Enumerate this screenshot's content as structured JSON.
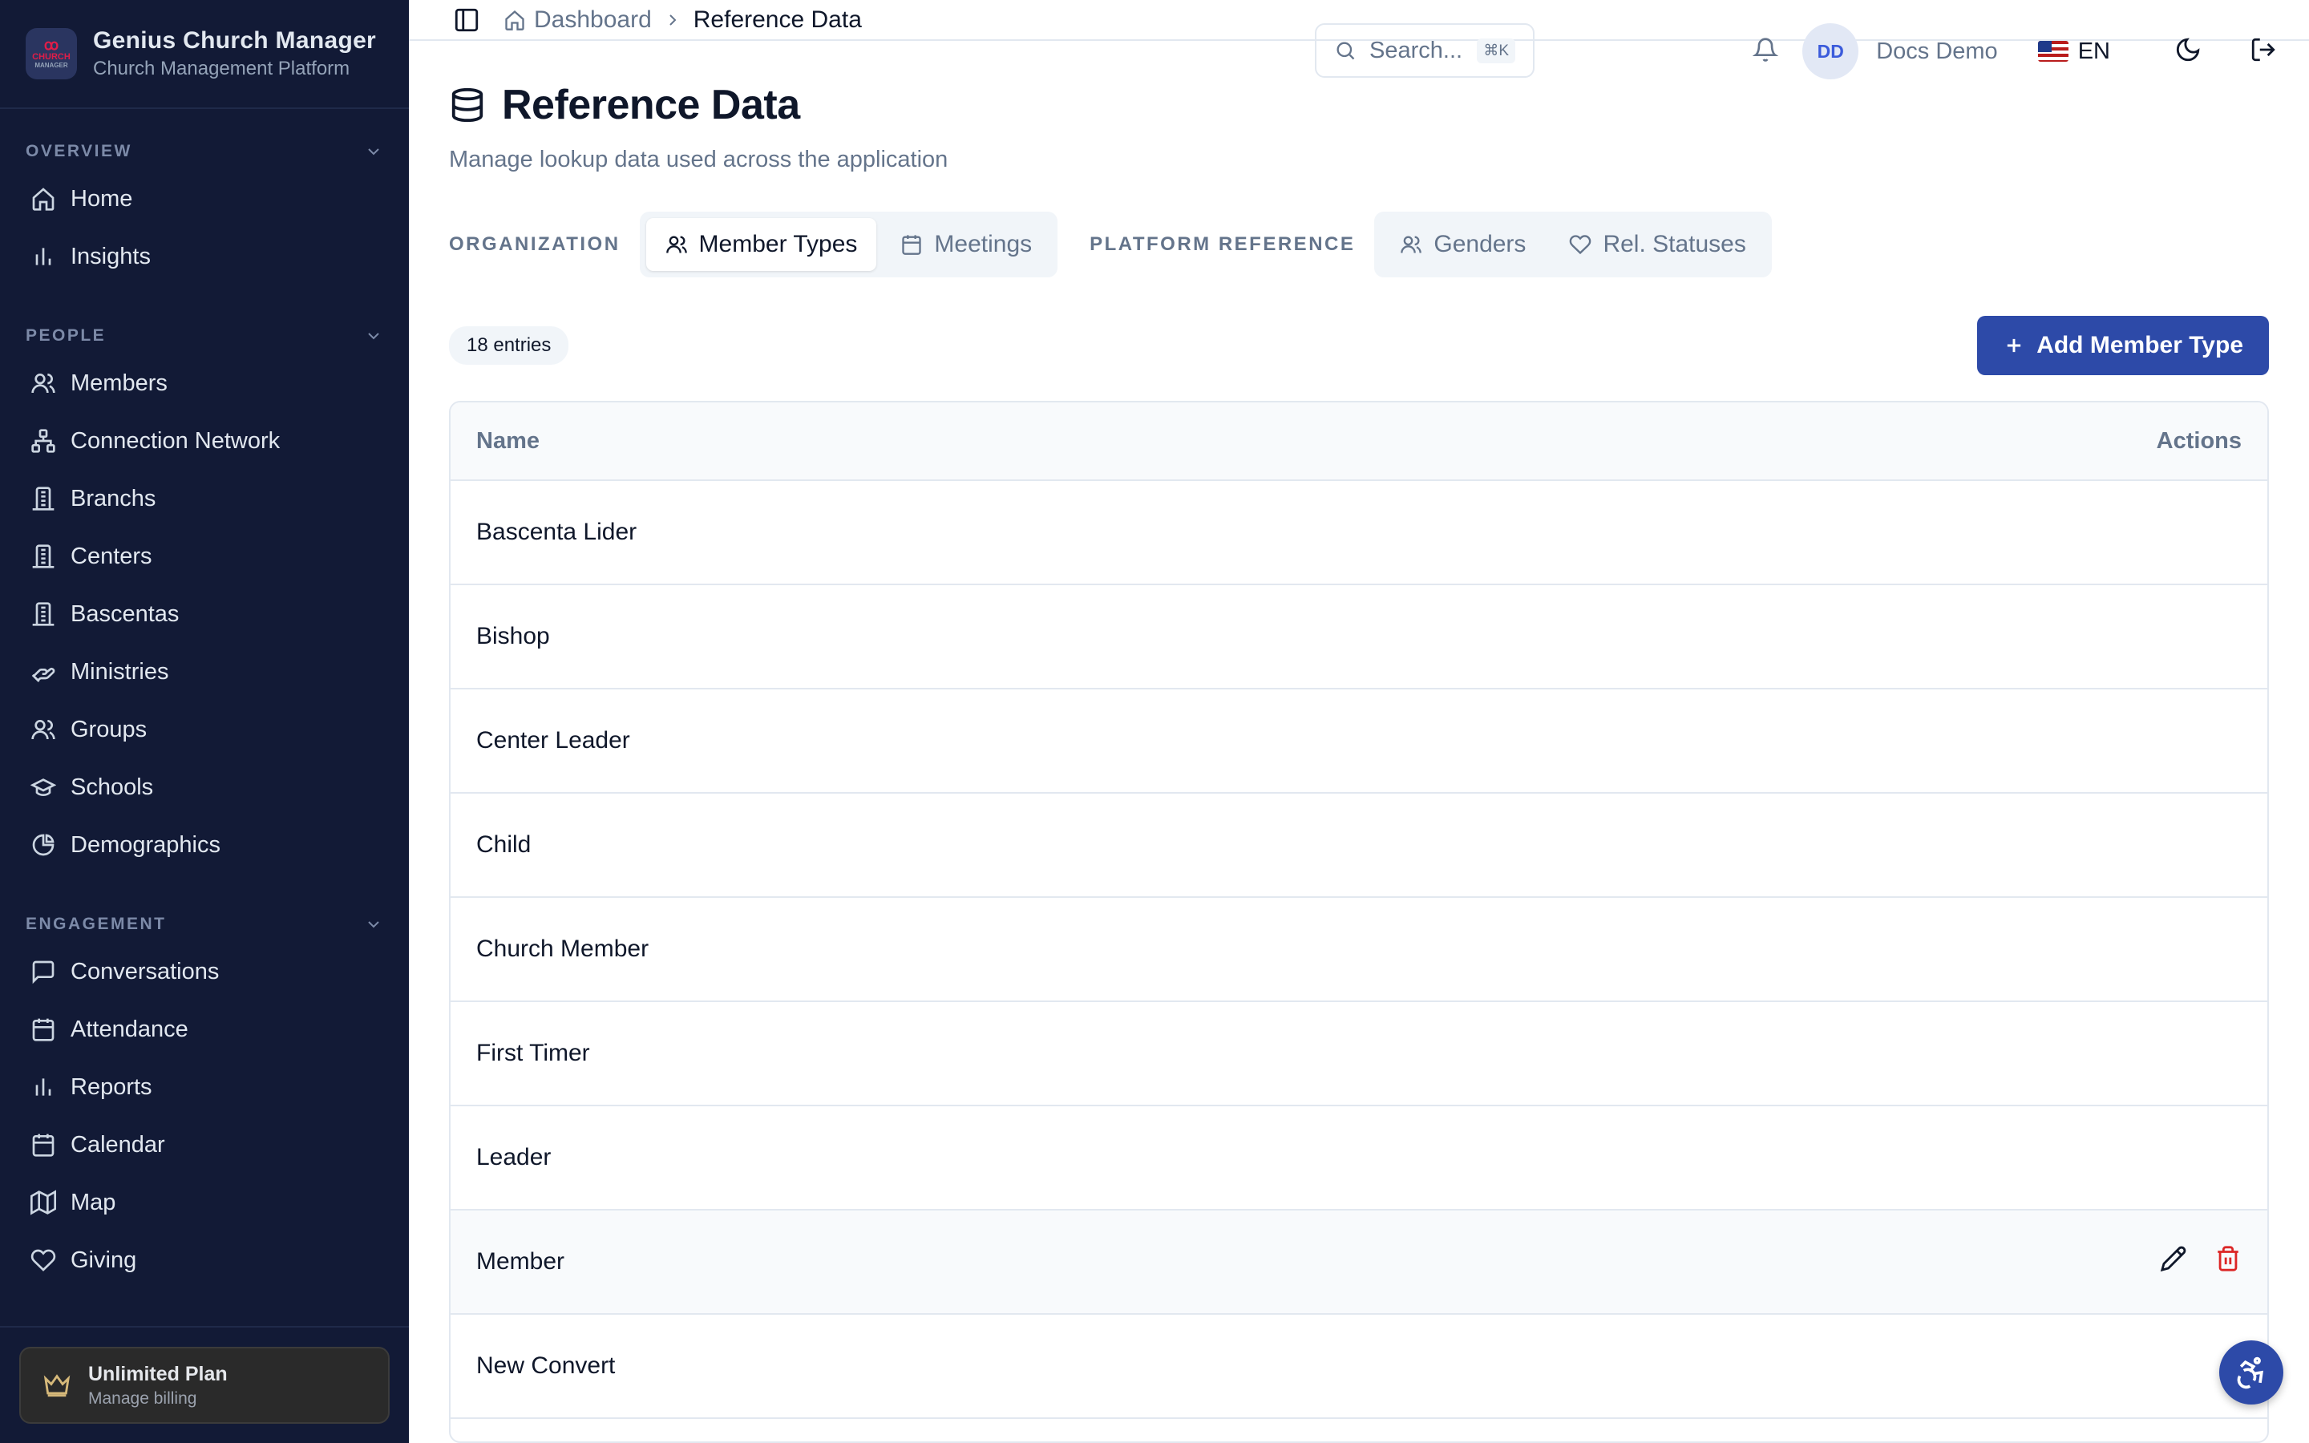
{
  "brand": {
    "logo_line1": "ꝏ",
    "logo_line2": "CHURCH",
    "logo_line3": "MANAGER",
    "title": "Genius Church Manager",
    "subtitle": "Church Management Platform"
  },
  "sidebar": {
    "sections": [
      {
        "label": "OVERVIEW",
        "items": [
          {
            "label": "Home",
            "icon": "home-icon"
          },
          {
            "label": "Insights",
            "icon": "bar-chart-icon"
          }
        ]
      },
      {
        "label": "PEOPLE",
        "items": [
          {
            "label": "Members",
            "icon": "users-icon"
          },
          {
            "label": "Connection Network",
            "icon": "network-icon"
          },
          {
            "label": "Branchs",
            "icon": "building-icon"
          },
          {
            "label": "Centers",
            "icon": "building-icon"
          },
          {
            "label": "Bascentas",
            "icon": "building-icon"
          },
          {
            "label": "Ministries",
            "icon": "hand-heart-icon"
          },
          {
            "label": "Groups",
            "icon": "users-icon"
          },
          {
            "label": "Schools",
            "icon": "graduation-cap-icon"
          },
          {
            "label": "Demographics",
            "icon": "pie-chart-icon"
          }
        ]
      },
      {
        "label": "ENGAGEMENT",
        "items": [
          {
            "label": "Conversations",
            "icon": "message-icon"
          },
          {
            "label": "Attendance",
            "icon": "calendar-icon"
          },
          {
            "label": "Reports",
            "icon": "bar-chart-icon"
          },
          {
            "label": "Calendar",
            "icon": "calendar-icon"
          },
          {
            "label": "Map",
            "icon": "map-icon"
          },
          {
            "label": "Giving",
            "icon": "heart-icon"
          }
        ]
      }
    ],
    "plan": {
      "title": "Unlimited Plan",
      "subtitle": "Manage billing"
    }
  },
  "topbar": {
    "breadcrumb_home": "Dashboard",
    "breadcrumb_current": "Reference Data",
    "search_placeholder": "Search...",
    "search_shortcut": "⌘K",
    "user_initials": "DD",
    "user_name": "Docs Demo",
    "language": "EN"
  },
  "page": {
    "title": "Reference Data",
    "subtitle": "Manage lookup data used across the application"
  },
  "tab_groups": [
    {
      "label": "ORGANIZATION",
      "tabs": [
        {
          "label": "Member Types",
          "active": true
        },
        {
          "label": "Meetings",
          "active": false
        }
      ]
    },
    {
      "label": "PLATFORM REFERENCE",
      "tabs": [
        {
          "label": "Genders",
          "active": false
        },
        {
          "label": "Rel. Statuses",
          "active": false
        }
      ]
    }
  ],
  "toolbar": {
    "count_label": "18 entries",
    "add_label": "Add Member Type"
  },
  "table": {
    "columns": [
      "Name",
      "Actions"
    ],
    "rows": [
      "Bascenta Lider",
      "Bishop",
      "Center Leader",
      "Child",
      "Church Member",
      "First Timer",
      "Leader",
      "Member",
      "New Convert"
    ],
    "hover_row_index": 7
  },
  "colors": {
    "sidebar_bg": "#121a36",
    "primary": "#2d4aa8",
    "danger": "#dc2626"
  }
}
